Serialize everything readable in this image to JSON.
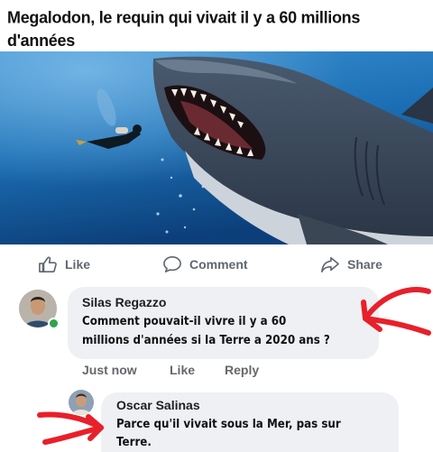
{
  "post": {
    "headline": "Megalodon, le requin qui vivait il y a 60 millions d'années"
  },
  "actions": {
    "like": "Like",
    "comment": "Comment",
    "share": "Share"
  },
  "comments": [
    {
      "author": "Silas Regazzo",
      "line1": "Comment pouvait-il vivre il y a 60",
      "line2": "millions d'années si la Terre a 2020 ans ?",
      "meta": {
        "time": "Just now",
        "like": "Like",
        "reply": "Reply"
      }
    },
    {
      "author": "Oscar Salinas",
      "line1": "Parce qu'il vivait sous la Mer, pas sur",
      "line2": "Terre."
    }
  ],
  "colors": {
    "ocean": "#1a6db0",
    "annotation_arrow": "#e8202a",
    "bubble": "#eef0f3",
    "action_text": "#606770"
  },
  "icons": [
    "thumbs-up-icon",
    "comment-icon",
    "share-icon"
  ]
}
